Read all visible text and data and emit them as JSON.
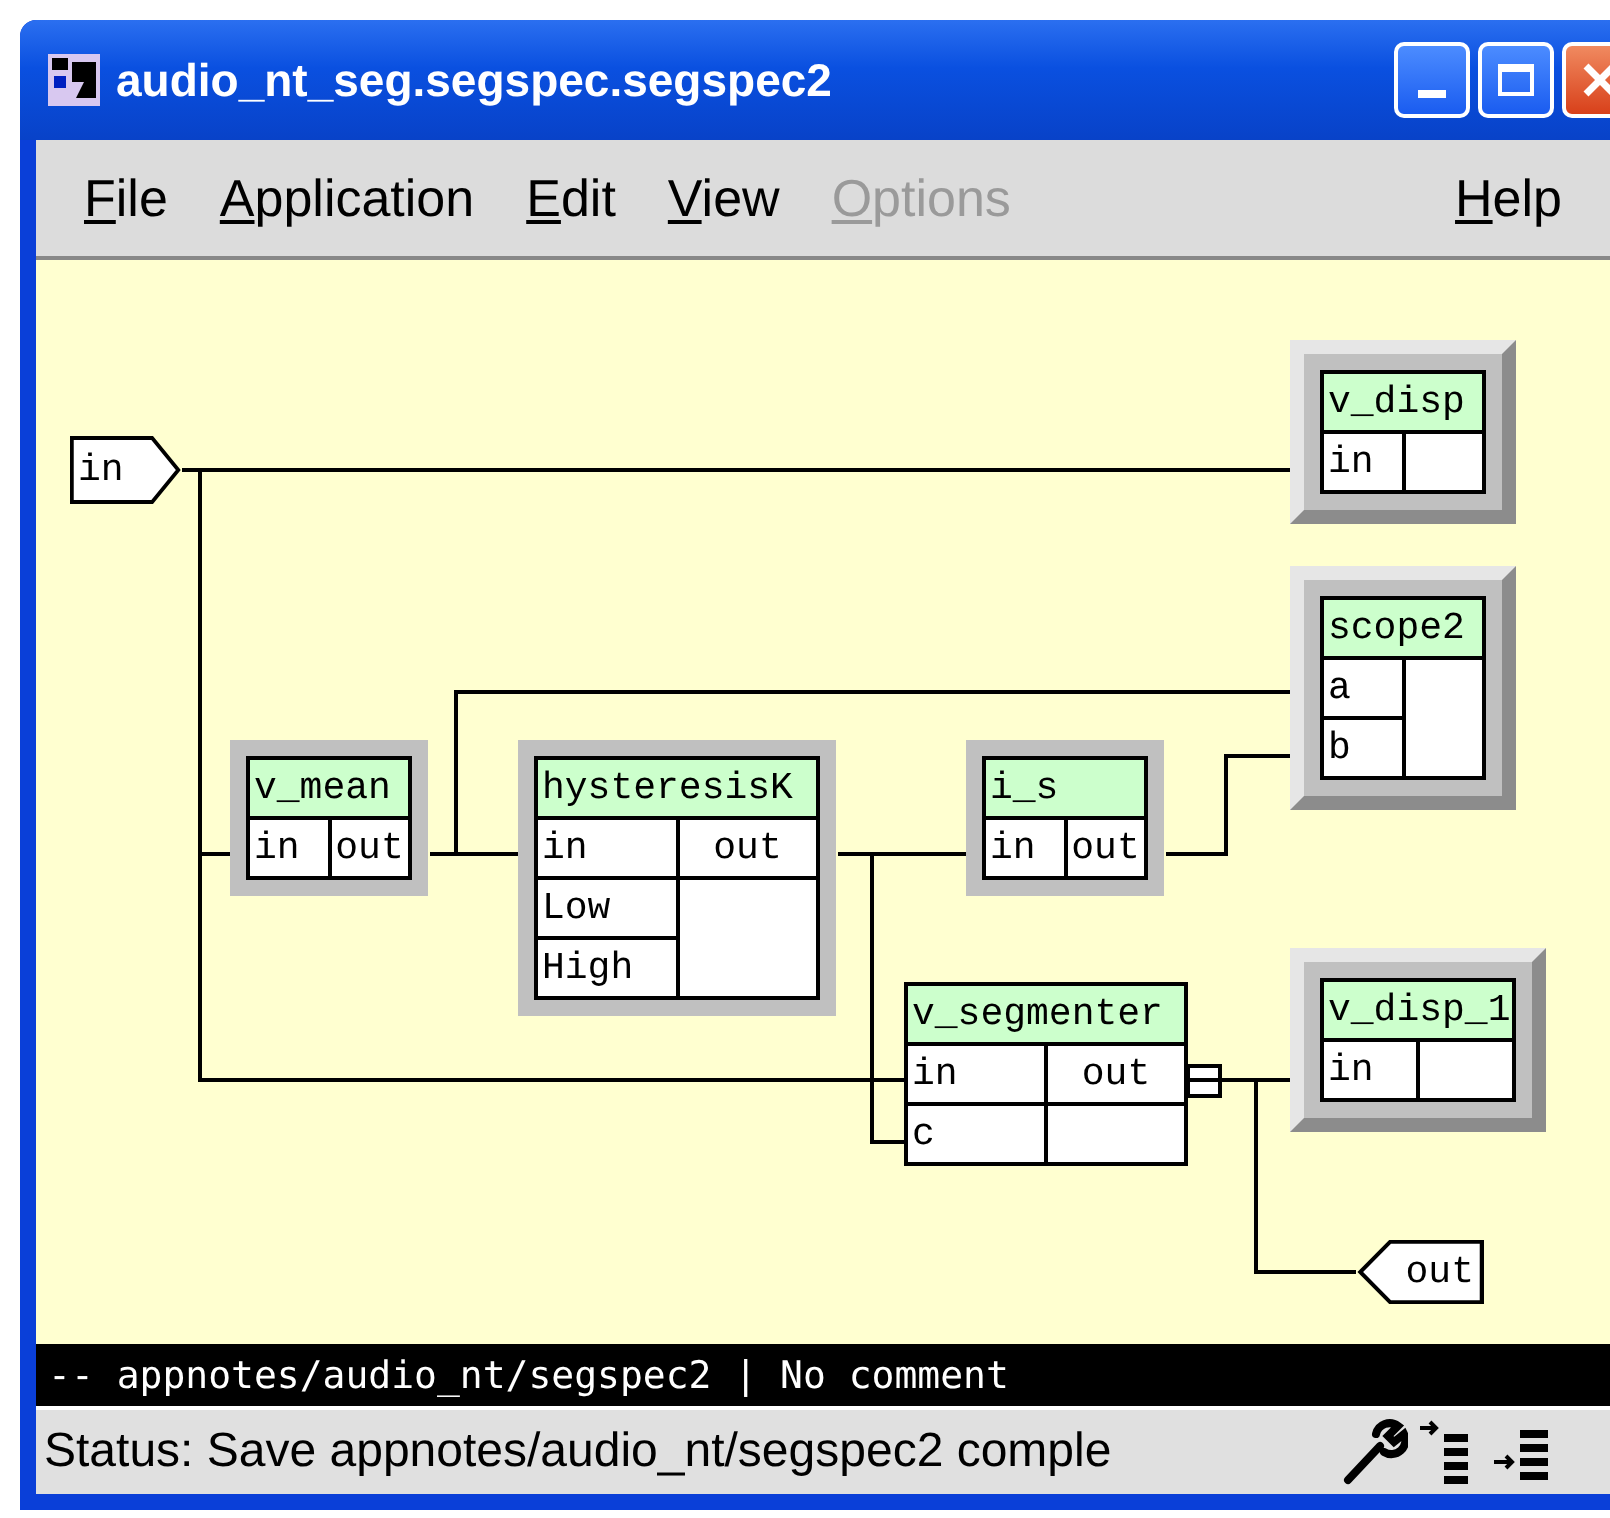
{
  "window": {
    "title": "audio_nt_seg.segspec.segspec2"
  },
  "menu": [
    {
      "label": "File",
      "disabled": false
    },
    {
      "label": "Application",
      "disabled": false
    },
    {
      "label": "Edit",
      "disabled": false
    },
    {
      "label": "View",
      "disabled": false
    },
    {
      "label": "Options",
      "disabled": true
    },
    {
      "label": "Help",
      "disabled": false
    }
  ],
  "canvas": {
    "ports": [
      {
        "label": "in",
        "kind": "input"
      },
      {
        "label": "out",
        "kind": "output"
      }
    ],
    "nodes": [
      {
        "title": "v_disp",
        "inputs": [
          "in"
        ],
        "kind": "raised"
      },
      {
        "title": "scope2",
        "inputs": [
          "a",
          "b"
        ],
        "kind": "raised"
      },
      {
        "title": "v_mean",
        "inputs": [
          "in"
        ],
        "output": "out",
        "kind": "flat"
      },
      {
        "title": "hysteresisK",
        "inputs": [
          "in",
          "Low",
          "High"
        ],
        "output": "out",
        "kind": "flat"
      },
      {
        "title": "i_s",
        "inputs": [
          "in"
        ],
        "output": "out",
        "kind": "flat"
      },
      {
        "title": "v_segmenter",
        "inputs": [
          "in",
          "c"
        ],
        "output": "out",
        "kind": "plain"
      },
      {
        "title": "v_disp_1",
        "inputs": [
          "in"
        ],
        "kind": "raised"
      }
    ]
  },
  "comment_bar": "-- appnotes/audio_nt/segspec2 | No comment",
  "status": "Status: Save appnotes/audio_nt/segspec2 comple"
}
